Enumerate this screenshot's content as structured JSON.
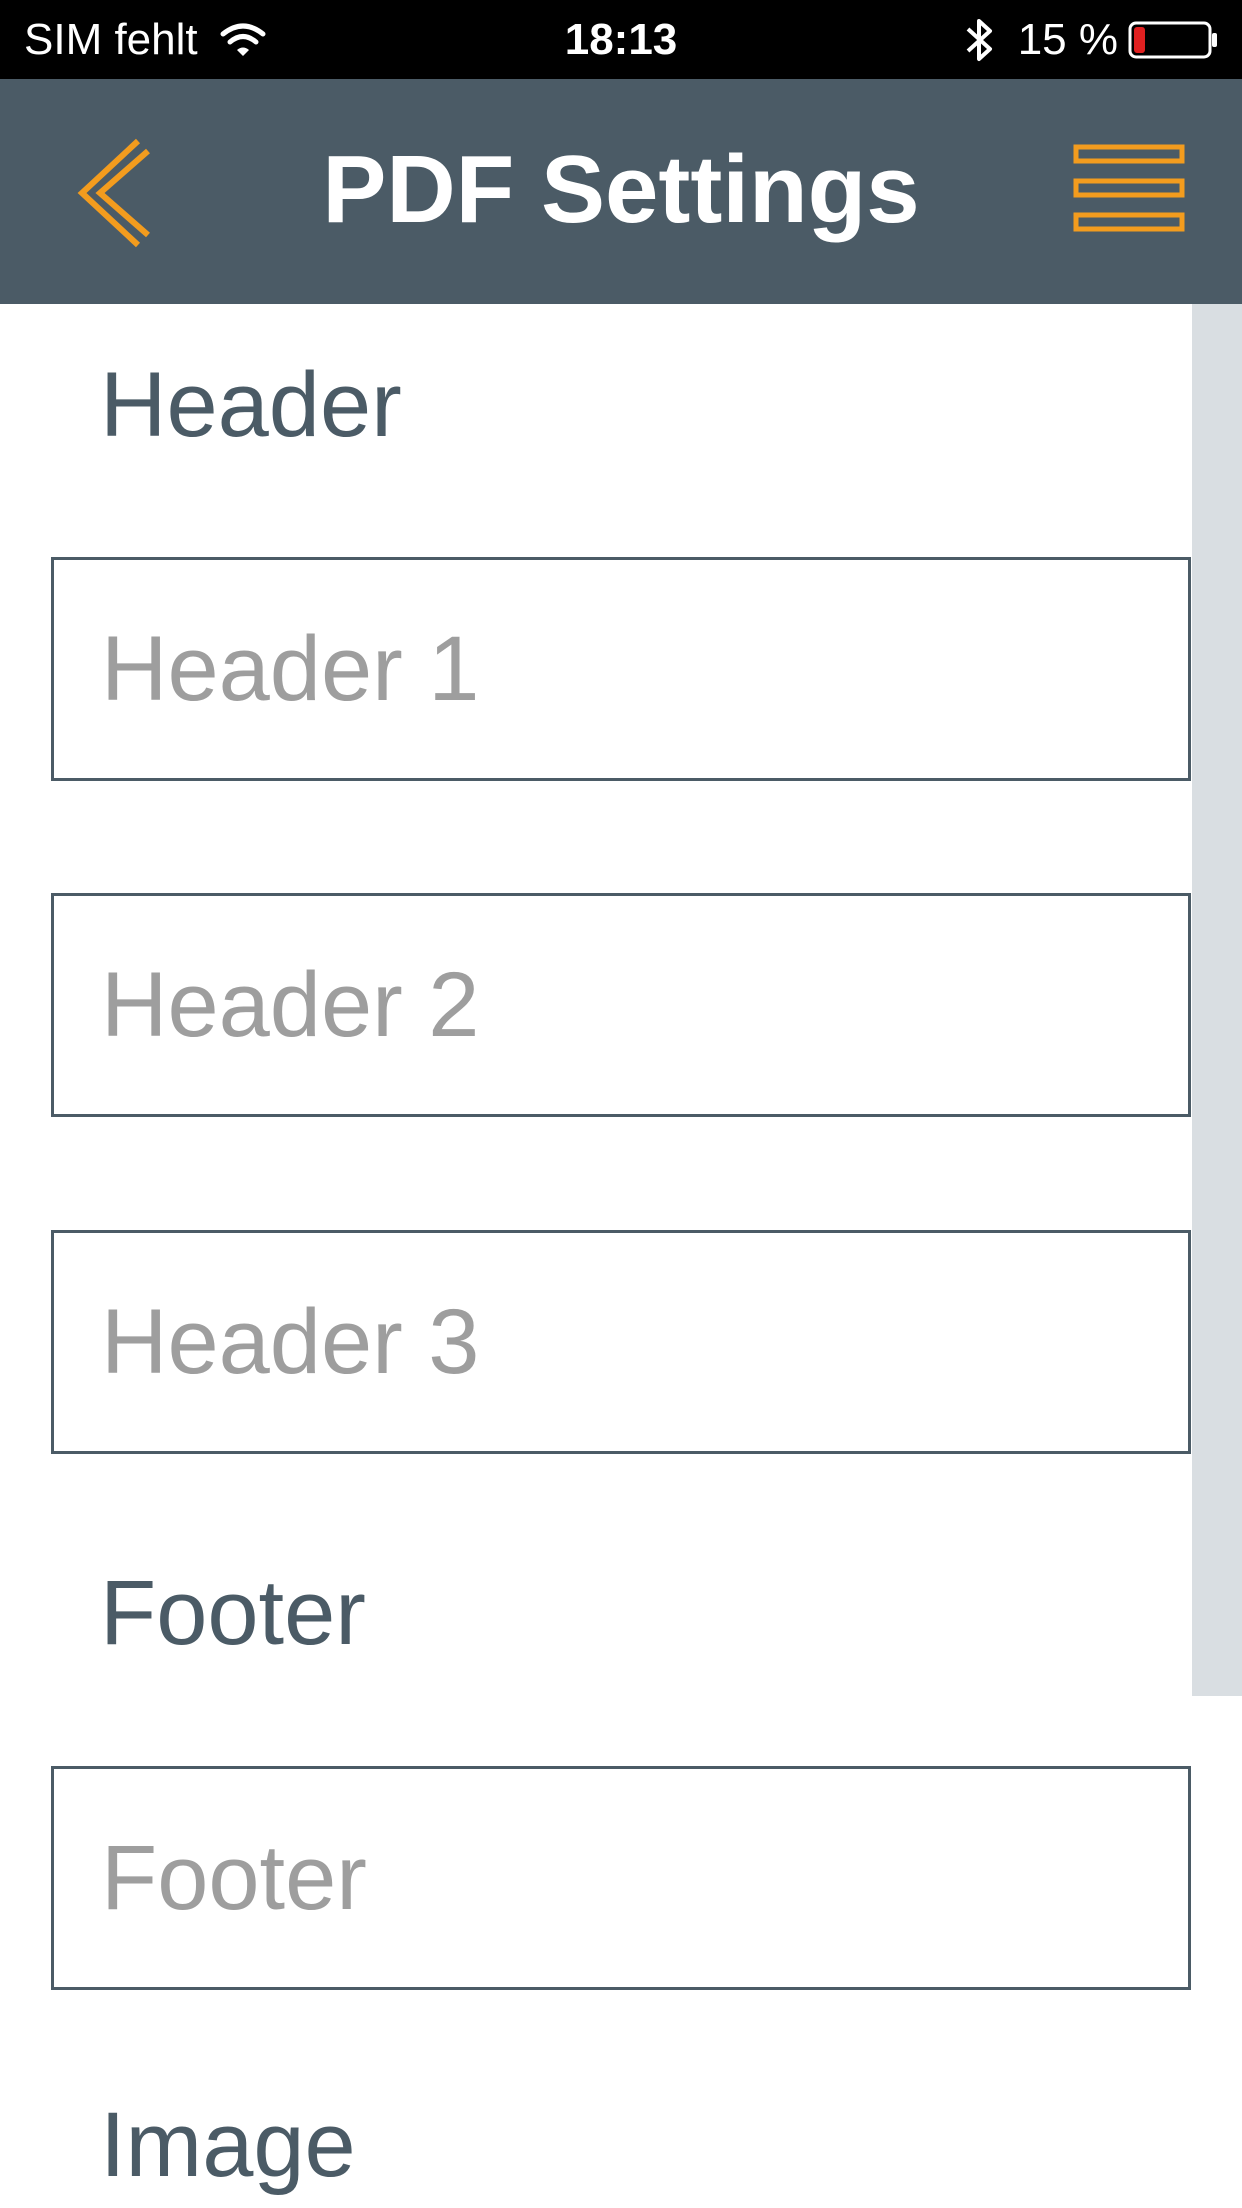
{
  "status_bar": {
    "carrier": "SIM fehlt",
    "time": "18:13",
    "battery_percent": "15 %",
    "battery_level": 0.15,
    "battery_color": "#e02020"
  },
  "nav": {
    "title": "PDF Settings",
    "back_icon": "chevron-left-icon",
    "menu_icon": "hamburger-menu-icon",
    "accent_color": "#f39c1e",
    "background_color": "#4b5b66"
  },
  "sections": {
    "header": {
      "label": "Header",
      "fields": [
        {
          "placeholder": "Header 1",
          "value": ""
        },
        {
          "placeholder": "Header 2",
          "value": ""
        },
        {
          "placeholder": "Header 3",
          "value": ""
        }
      ]
    },
    "footer": {
      "label": "Footer",
      "fields": [
        {
          "placeholder": "Footer",
          "value": ""
        }
      ]
    },
    "image": {
      "label": "Image"
    }
  }
}
